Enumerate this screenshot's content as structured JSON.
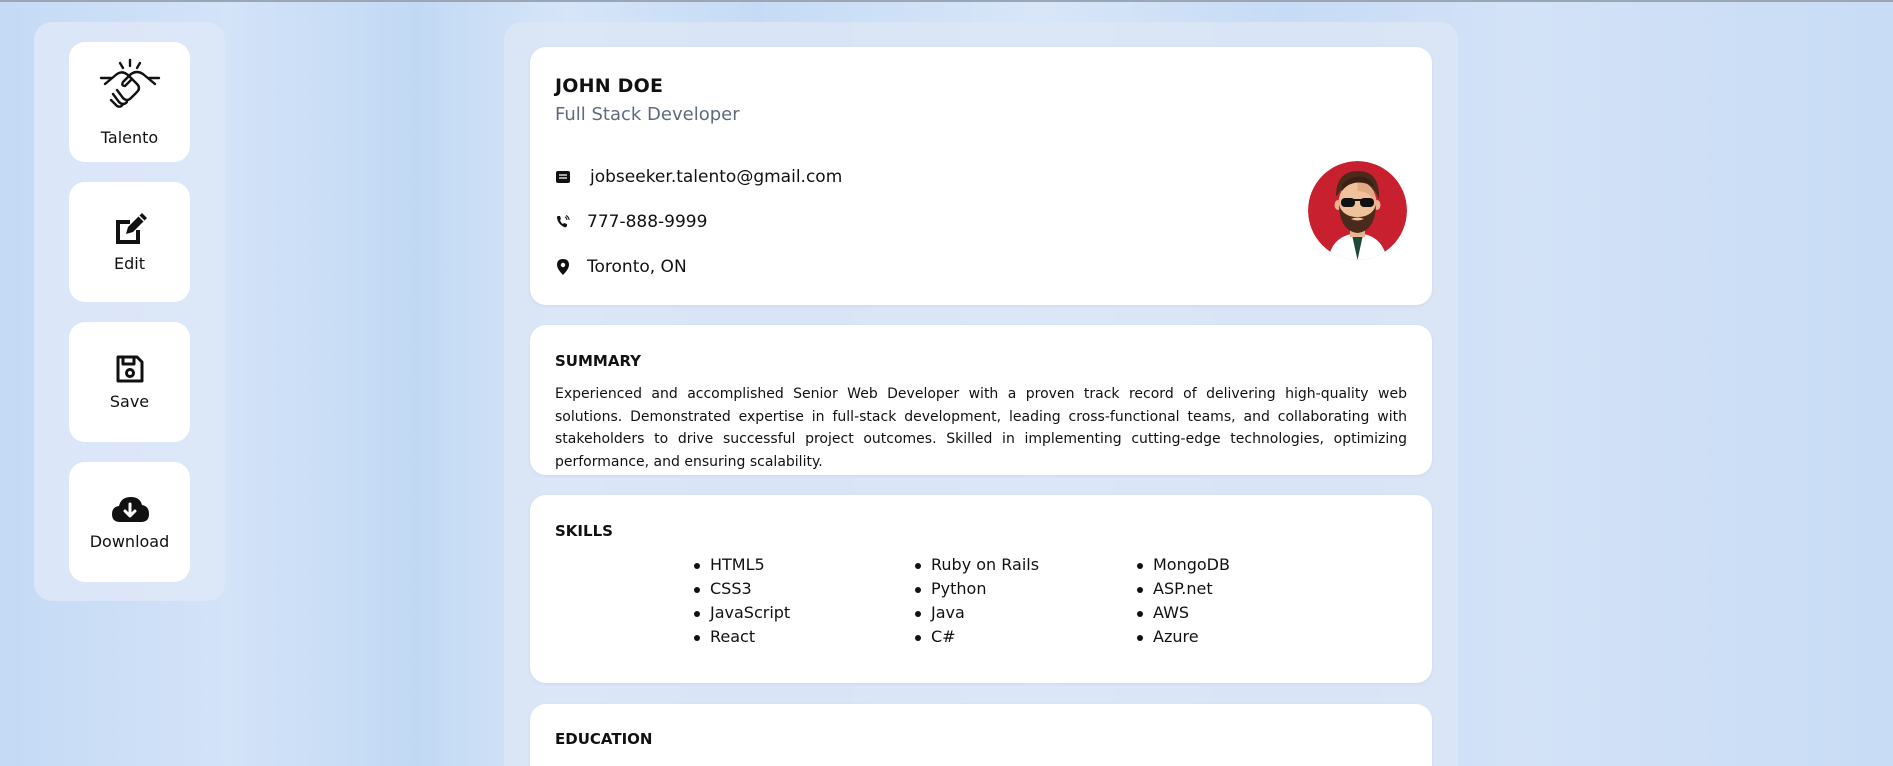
{
  "sidebar": {
    "items": [
      {
        "label": "Talento",
        "icon": "handshake-icon"
      },
      {
        "label": "Edit",
        "icon": "edit-icon"
      },
      {
        "label": "Save",
        "icon": "floppy-disk-icon"
      },
      {
        "label": "Download",
        "icon": "cloud-download-icon"
      }
    ]
  },
  "profile": {
    "name": "JOHN DOE",
    "role": "Full Stack Developer",
    "email": "jobseeker.talento@gmail.com",
    "phone": "777-888-9999",
    "location": "Toronto, ON",
    "avatar_icon": "avatar-icon"
  },
  "summary": {
    "title": "SUMMARY",
    "text": "Experienced and accomplished Senior Web Developer with a proven track record of delivering high-quality web solutions. Demonstrated expertise in full-stack development, leading cross-functional teams, and collaborating with stakeholders to drive successful project outcomes. Skilled in implementing cutting-edge technologies, optimizing performance, and ensuring scalability."
  },
  "skills": {
    "title": "SKILLS",
    "columns": [
      [
        "HTML5",
        "CSS3",
        "JavaScript",
        "React"
      ],
      [
        "Ruby on Rails",
        "Python",
        "Java",
        "C#"
      ],
      [
        "MongoDB",
        "ASP.net",
        "AWS",
        "Azure"
      ]
    ]
  },
  "education": {
    "title": "EDUCATION"
  },
  "colors": {
    "avatar_bg": "#c8202e",
    "role_text": "#5f6b7d"
  }
}
